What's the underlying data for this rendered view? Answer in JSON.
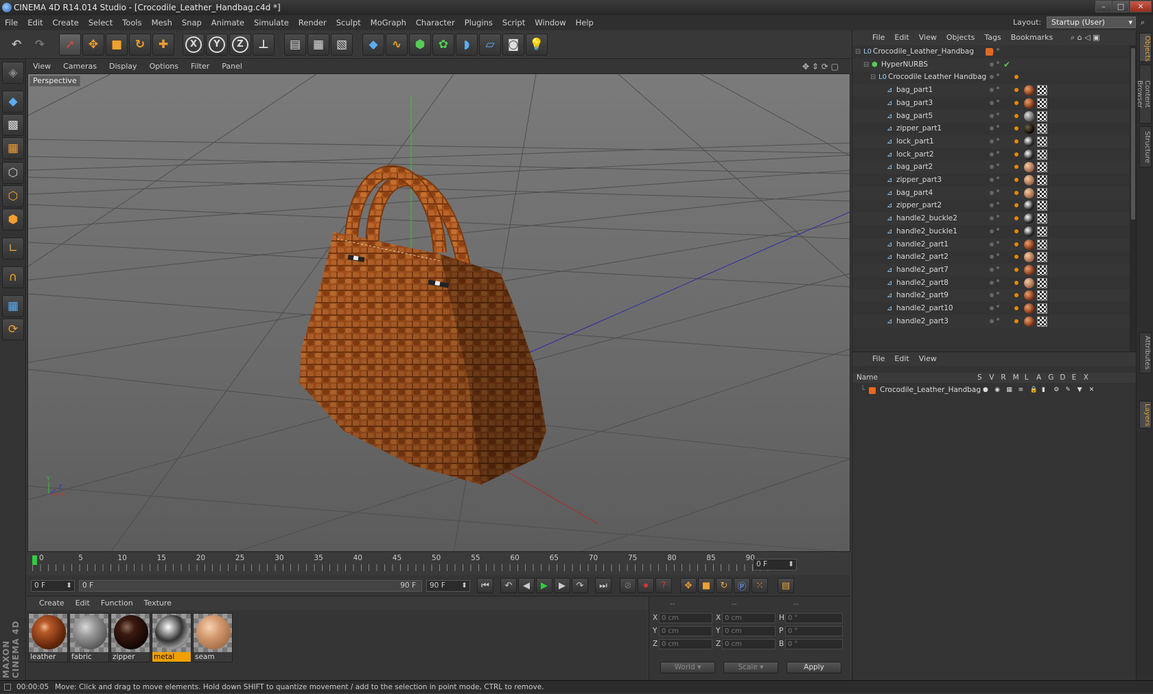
{
  "window": {
    "title": "CINEMA 4D R14.014 Studio - [Crocodile_Leather_Handbag.c4d *]",
    "layout_label": "Layout:",
    "layout_value": "Startup (User)"
  },
  "menu": [
    "File",
    "Edit",
    "Create",
    "Select",
    "Tools",
    "Mesh",
    "Snap",
    "Animate",
    "Simulate",
    "Render",
    "Sculpt",
    "MoGraph",
    "Character",
    "Plugins",
    "Script",
    "Window",
    "Help"
  ],
  "viewport": {
    "menu": [
      "View",
      "Cameras",
      "Display",
      "Options",
      "Filter",
      "Panel"
    ],
    "label": "Perspective"
  },
  "timeline": {
    "ticks": [
      "0",
      "5",
      "10",
      "15",
      "20",
      "25",
      "30",
      "35",
      "40",
      "45",
      "50",
      "55",
      "60",
      "65",
      "70",
      "75",
      "80",
      "85",
      "90"
    ],
    "current_frame": "0 F",
    "start_frame": "0 F",
    "range_start": "0 F",
    "range_end": "90 F",
    "end_frame": "90 F"
  },
  "materials": {
    "menu": [
      "Create",
      "Edit",
      "Function",
      "Texture"
    ],
    "items": [
      {
        "name": "leather",
        "active": false
      },
      {
        "name": "fabric",
        "active": false
      },
      {
        "name": "zipper",
        "active": false
      },
      {
        "name": "metal",
        "active": true
      },
      {
        "name": "seam",
        "active": false
      }
    ]
  },
  "coords": {
    "header": [
      "--",
      "--",
      "--"
    ],
    "rows": [
      {
        "a": "X",
        "av": "0 cm",
        "b": "X",
        "bv": "0 cm",
        "c": "H",
        "cv": "0 °"
      },
      {
        "a": "Y",
        "av": "0 cm",
        "b": "Y",
        "bv": "0 cm",
        "c": "P",
        "cv": "0 °"
      },
      {
        "a": "Z",
        "av": "0 cm",
        "b": "Z",
        "bv": "0 cm",
        "c": "B",
        "cv": "0 °"
      }
    ],
    "world": "World",
    "scale": "Scale",
    "apply": "Apply"
  },
  "objects": {
    "menu": [
      "File",
      "Edit",
      "View",
      "Objects",
      "Tags",
      "Bookmarks"
    ],
    "root": "Crocodile_Leather_Handbag",
    "hypernurbs": "HyperNURBS",
    "group": "Crocodile Leather Handbag",
    "parts": [
      {
        "name": "bag_part1",
        "mat": "leather"
      },
      {
        "name": "bag_part3",
        "mat": "leather"
      },
      {
        "name": "bag_part5",
        "mat": "fabric"
      },
      {
        "name": "zipper_part1",
        "mat": "zipper"
      },
      {
        "name": "lock_part1",
        "mat": "metal"
      },
      {
        "name": "lock_part2",
        "mat": "metal"
      },
      {
        "name": "bag_part2",
        "mat": "seam"
      },
      {
        "name": "zipper_part3",
        "mat": "seam"
      },
      {
        "name": "bag_part4",
        "mat": "seam"
      },
      {
        "name": "zipper_part2",
        "mat": "metal"
      },
      {
        "name": "handle2_buckle2",
        "mat": "metal"
      },
      {
        "name": "handle2_buckle1",
        "mat": "metal"
      },
      {
        "name": "handle2_part1",
        "mat": "leather"
      },
      {
        "name": "handle2_part2",
        "mat": "seam"
      },
      {
        "name": "handle2_part7",
        "mat": "leather"
      },
      {
        "name": "handle2_part8",
        "mat": "seam"
      },
      {
        "name": "handle2_part9",
        "mat": "leather"
      },
      {
        "name": "handle2_part10",
        "mat": "leather"
      },
      {
        "name": "handle2_part3",
        "mat": "leather"
      }
    ]
  },
  "layers": {
    "menu": [
      "File",
      "Edit",
      "View"
    ],
    "columns": [
      "Name",
      "S",
      "V",
      "R",
      "M",
      "L",
      "A",
      "G",
      "D",
      "E",
      "X"
    ],
    "items": [
      "Crocodile_Leather_Handbag"
    ]
  },
  "right_tabs": [
    "Objects",
    "Content Browser",
    "Structure",
    "Attributes",
    "Layers"
  ],
  "status": {
    "time": "00:00:05",
    "message": "Move: Click and drag to move elements. Hold down SHIFT to quantize movement / add to the selection in point mode, CTRL to remove."
  },
  "branding": "MAXON CINEMA 4D",
  "colors": {
    "accent": "#f0a000",
    "viewport_bg": "#737373",
    "leather": "#a8521c"
  }
}
